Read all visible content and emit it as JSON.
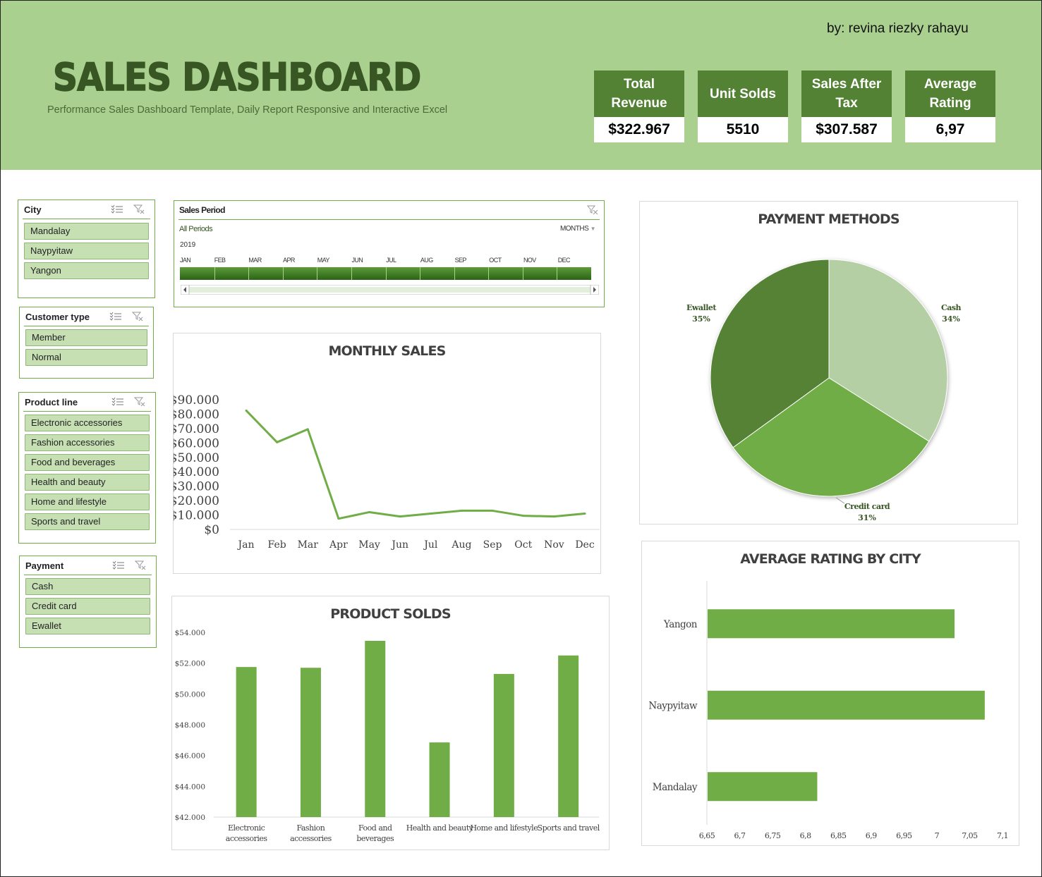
{
  "header": {
    "author": "by: revina riezky rahayu",
    "title": "SALES DASHBOARD",
    "subtitle": "Performance Sales Dashboard Template, Daily Report Responsive and Interactive Excel"
  },
  "kpis": [
    {
      "label": "Total Revenue",
      "value": "$322.967"
    },
    {
      "label": "Unit Solds",
      "value": "5510"
    },
    {
      "label": "Sales After Tax",
      "value": "$307.587"
    },
    {
      "label": "Average Rating",
      "value": "6,97"
    }
  ],
  "slicers": {
    "city": {
      "title": "City",
      "items": [
        "Mandalay",
        "Naypyitaw",
        "Yangon"
      ]
    },
    "customer_type": {
      "title": "Customer type",
      "items": [
        "Member",
        "Normal"
      ]
    },
    "product_line": {
      "title": "Product line",
      "items": [
        "Electronic accessories",
        "Fashion accessories",
        "Food and beverages",
        "Health and beauty",
        "Home and lifestyle",
        "Sports and travel"
      ]
    },
    "payment": {
      "title": "Payment",
      "items": [
        "Cash",
        "Credit card",
        "Ewallet"
      ]
    }
  },
  "timeline": {
    "title": "Sales Period",
    "selection": "All Periods",
    "level": "MONTHS",
    "year": "2019",
    "months": [
      "JAN",
      "FEB",
      "MAR",
      "APR",
      "MAY",
      "JUN",
      "JUL",
      "AUG",
      "SEP",
      "OCT",
      "NOV",
      "DEC"
    ]
  },
  "colors": {
    "header_bg": "#a9d08e",
    "kpi_head": "#548235",
    "title": "#375623",
    "accent": "#70ad47",
    "pie_dark": "#548235",
    "pie_mid": "#70ad47",
    "pie_light": "#b4cfa4"
  },
  "icons": {
    "slicer_multiselect": "multi-select-icon",
    "slicer_clear": "clear-filter-icon",
    "scroll_left": "scroll-left-icon",
    "scroll_right": "scroll-right-icon"
  },
  "chart_data": [
    {
      "id": "monthly_sales",
      "type": "line",
      "title": "MONTHLY SALES",
      "categories": [
        "Jan",
        "Feb",
        "Mar",
        "Apr",
        "May",
        "Jun",
        "Jul",
        "Aug",
        "Sep",
        "Oct",
        "Nov",
        "Dec"
      ],
      "values": [
        82500,
        60500,
        69500,
        7500,
        12000,
        9000,
        11000,
        13000,
        13000,
        9500,
        9000,
        11000
      ],
      "ylim": [
        0,
        90000
      ],
      "yticks": [
        "$0",
        "$10.000",
        "$20.000",
        "$30.000",
        "$40.000",
        "$50.000",
        "$60.000",
        "$70.000",
        "$80.000",
        "$90.000"
      ],
      "grid": false
    },
    {
      "id": "product_solds",
      "type": "bar",
      "title": "PRODUCT SOLDS",
      "categories": [
        "Electronic accessories",
        "Fashion accessories",
        "Food and beverages",
        "Health and beauty",
        "Home and lifestyle",
        "Sports and travel"
      ],
      "values": [
        51750,
        51700,
        53450,
        46850,
        51300,
        52500
      ],
      "ylim": [
        42000,
        54000
      ],
      "yticks": [
        "$42.000",
        "$44.000",
        "$46.000",
        "$48.000",
        "$50.000",
        "$52.000",
        "$54.000"
      ],
      "grid": false
    },
    {
      "id": "payment_methods",
      "type": "pie",
      "title": "PAYMENT METHODS",
      "categories": [
        "Cash",
        "Credit card",
        "Ewallet"
      ],
      "values": [
        34,
        31,
        35
      ],
      "labels": [
        "34%",
        "31%",
        "35%"
      ]
    },
    {
      "id": "avg_rating_city",
      "type": "bar",
      "orientation": "horizontal",
      "title": "AVERAGE RATING BY CITY",
      "categories": [
        "Yangon",
        "Naypyitaw",
        "Mandalay"
      ],
      "values": [
        7.027,
        7.073,
        6.818
      ],
      "xlim": [
        6.65,
        7.1
      ],
      "xticks": [
        "6,65",
        "6,7",
        "6,75",
        "6,8",
        "6,85",
        "6,9",
        "6,95",
        "7",
        "7,05",
        "7,1"
      ],
      "grid": false
    }
  ]
}
